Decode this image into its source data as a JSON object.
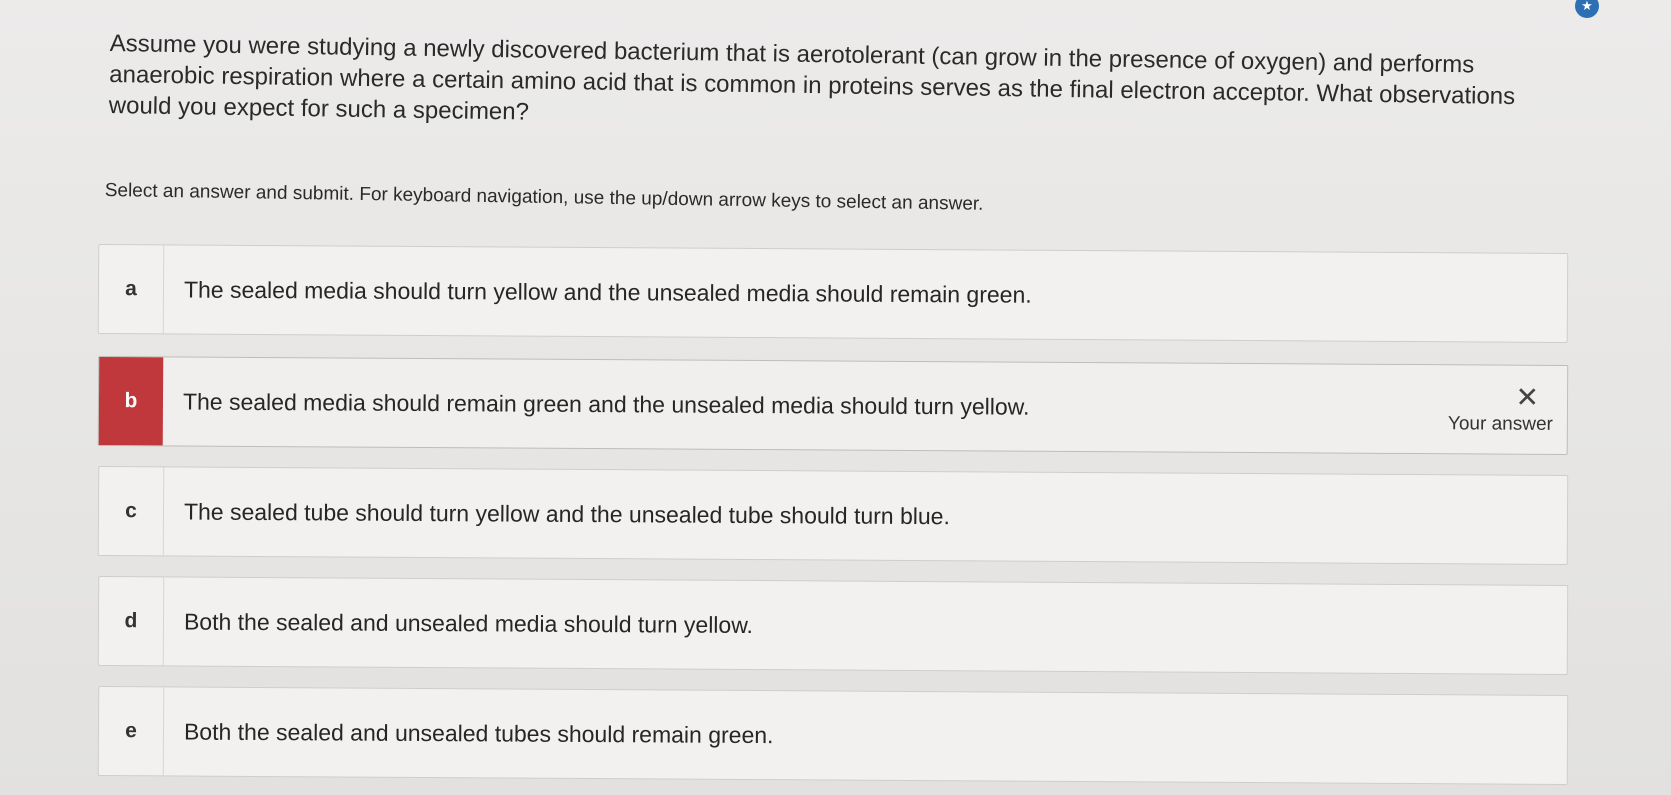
{
  "question": {
    "text": "Assume you were studying a newly discovered bacterium that is aerotolerant (can grow in the presence of oxygen) and performs anaerobic respiration where a certain amino acid that is common in proteins serves as the final electron acceptor. What observations would you expect for such a specimen?",
    "instruction": "Select an answer and submit. For keyboard navigation, use the up/down arrow keys to select an answer."
  },
  "options": [
    {
      "letter": "a",
      "text": "The sealed media should turn yellow and the unsealed media should remain green.",
      "state": "default"
    },
    {
      "letter": "b",
      "text": "The sealed media should remain green and the unsealed media should turn yellow.",
      "state": "incorrect",
      "feedback_icon": "x-icon",
      "feedback_label": "Your answer"
    },
    {
      "letter": "c",
      "text": "The sealed tube should turn yellow and the unsealed tube should turn blue.",
      "state": "default"
    },
    {
      "letter": "d",
      "text": "Both the sealed and unsealed media should turn yellow.",
      "state": "default"
    },
    {
      "letter": "e",
      "text": "Both the sealed and unsealed tubes should remain green.",
      "state": "default"
    }
  ],
  "colors": {
    "incorrect_accent": "#c0373c",
    "badge": "#2d6fb3"
  },
  "icons": {
    "corner_badge": "star-badge-icon"
  }
}
